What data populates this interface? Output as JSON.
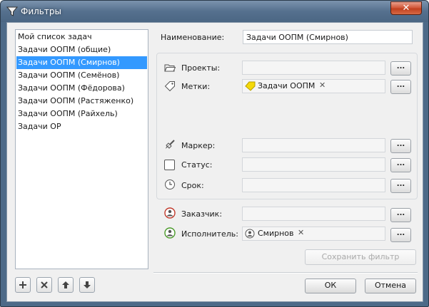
{
  "window": {
    "title": "Фильтры",
    "close_glyph": "✕",
    "app_icon": "funnel-icon",
    "accent_color": "#3399ff"
  },
  "filter_list": {
    "items": [
      {
        "label": "Мой список задач",
        "selected": false
      },
      {
        "label": "Задачи ООПМ (общие)",
        "selected": false
      },
      {
        "label": "Задачи ООПМ (Смирнов)",
        "selected": true
      },
      {
        "label": "Задачи ООПМ (Семёнов)",
        "selected": false
      },
      {
        "label": "Задачи ООПМ (Фёдорова)",
        "selected": false
      },
      {
        "label": "Задачи ООПМ (Растяженко)",
        "selected": false
      },
      {
        "label": "Задачи ООПМ (Райхель)",
        "selected": false
      },
      {
        "label": "Задачи ОР",
        "selected": false
      }
    ],
    "buttons": [
      {
        "name": "add-filter-button",
        "icon": "plus-icon"
      },
      {
        "name": "delete-filter-button",
        "icon": "x-icon"
      },
      {
        "name": "move-up-button",
        "icon": "arrow-up-icon"
      },
      {
        "name": "move-down-button",
        "icon": "arrow-down-icon"
      }
    ]
  },
  "form": {
    "name_label": "Наименование:",
    "name_value": "Задачи ООПМ (Смирнов)",
    "projects_label": "Проекты:",
    "projects_value": "",
    "tags_label": "Метки:",
    "tags_chip": "Задачи ООПМ",
    "tags_chip_remove": "✕",
    "marker_label": "Маркер:",
    "marker_value": "",
    "status_label": "Статус:",
    "status_value": "",
    "deadline_label": "Срок:",
    "deadline_value": "",
    "customer_label": "Заказчик:",
    "customer_value": "",
    "assignee_label": "Исполнитель:",
    "assignee_chip": "Смирнов",
    "assignee_chip_remove": "✕",
    "browse_label": "...",
    "save_filter_label": "Сохранить фильтр"
  },
  "dialog_buttons": {
    "ok_label": "ОК",
    "cancel_label": "Отмена"
  }
}
